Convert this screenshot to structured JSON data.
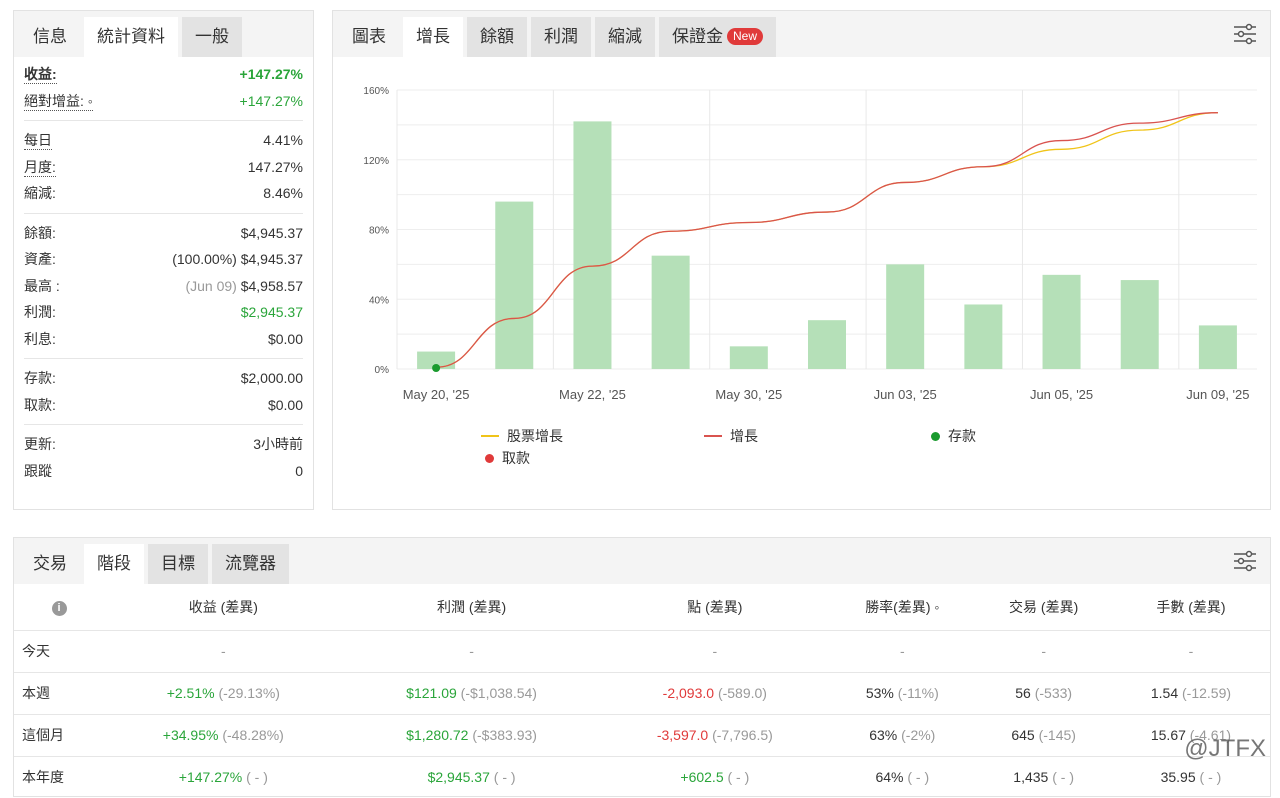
{
  "left": {
    "tabs": [
      "信息",
      "統計資料",
      "一般"
    ],
    "rows": [
      [
        {
          "k": "收益:",
          "v": "+147.27%",
          "c": "green",
          "b": true
        },
        {
          "k": "絕對增益: ◦",
          "v": "+147.27%",
          "c": "green"
        }
      ],
      [
        {
          "k": "每日",
          "v": "4.41%"
        },
        {
          "k": "月度:",
          "v": "147.27%"
        },
        {
          "k": "縮減:",
          "v": "8.46%",
          "nd": true
        }
      ],
      [
        {
          "k": "餘額:",
          "v": "$4,945.37",
          "nd": true
        },
        {
          "k": "資產:",
          "pre": "(100.00%)",
          "v": "$4,945.37",
          "nd": true
        },
        {
          "k": "最高 :",
          "pre": "(Jun 09)",
          "v": "$4,958.57",
          "nd": true
        },
        {
          "k": "利潤:",
          "v": "$2,945.37",
          "c": "green",
          "nd": true
        },
        {
          "k": "利息:",
          "v": "$0.00",
          "nd": true
        }
      ],
      [
        {
          "k": "存款:",
          "v": "$2,000.00",
          "nd": true
        },
        {
          "k": "取款:",
          "v": "$0.00",
          "nd": true
        }
      ],
      [
        {
          "k": "更新:",
          "v": "3小時前",
          "nd": true
        },
        {
          "k": "跟蹤",
          "v": "0",
          "nd": true
        }
      ]
    ]
  },
  "chart_tabs": [
    "圖表",
    "增長",
    "餘額",
    "利潤",
    "縮減",
    "保證金"
  ],
  "new_badge": "New",
  "chart_data": {
    "type": "bar+line",
    "yticks": [
      "0%",
      "40%",
      "80%",
      "120%",
      "160%"
    ],
    "ylim": [
      0,
      160
    ],
    "xlabels": [
      "May 20, '25",
      "May 22, '25",
      "May 30, '25",
      "Jun 03, '25",
      "Jun 05, '25",
      "Jun 09, '25"
    ],
    "bars": [
      10,
      96,
      142,
      65,
      13,
      28,
      60,
      37,
      54,
      51,
      25
    ],
    "growth": [
      1,
      29,
      59,
      79,
      84,
      90,
      107,
      116,
      131,
      141,
      147
    ],
    "equity_growth": [
      1,
      29,
      59,
      79,
      84,
      90,
      107,
      116,
      126,
      137,
      147
    ],
    "deposit_index": 0,
    "legend": [
      "股票增長",
      "增長",
      "存款",
      "取款"
    ],
    "colors": {
      "bar": "#b5e0b8",
      "growth": "#d9534f",
      "equity": "#f0c419",
      "deposit": "#1a9a2e",
      "withdraw": "#e03a3a"
    }
  },
  "bottom": {
    "tabs": [
      "交易",
      "階段",
      "目標",
      "流覽器"
    ],
    "headers": [
      "收益 (差異)",
      "利潤 (差異)",
      "點 (差異)",
      "勝率(差異) ◦",
      "交易 (差異)",
      "手數 (差異)"
    ],
    "rows": [
      {
        "label": "今天",
        "cells": [
          [
            "-",
            "",
            ""
          ],
          [
            "-",
            "",
            ""
          ],
          [
            "-",
            "",
            ""
          ],
          [
            "-",
            "",
            ""
          ],
          [
            "-",
            "",
            ""
          ],
          [
            "-",
            "",
            ""
          ]
        ]
      },
      {
        "label": "本週",
        "cells": [
          [
            "+2.51%",
            "(-29.13%)",
            "green"
          ],
          [
            "$121.09",
            "(-$1,038.54)",
            "green"
          ],
          [
            "-2,093.0",
            "(-589.0)",
            "red"
          ],
          [
            "53%",
            "(-11%)",
            ""
          ],
          [
            "56",
            "(-533)",
            ""
          ],
          [
            "1.54",
            "(-12.59)",
            ""
          ]
        ]
      },
      {
        "label": "這個月",
        "cells": [
          [
            "+34.95%",
            "(-48.28%)",
            "green"
          ],
          [
            "$1,280.72",
            "(-$383.93)",
            "green"
          ],
          [
            "-3,597.0",
            "(-7,796.5)",
            "red"
          ],
          [
            "63%",
            "(-2%)",
            ""
          ],
          [
            "645",
            "(-145)",
            ""
          ],
          [
            "15.67",
            "(-4.61)",
            ""
          ]
        ]
      },
      {
        "label": "本年度",
        "cells": [
          [
            "+147.27%",
            "( - )",
            "green"
          ],
          [
            "$2,945.37",
            "( - )",
            "green"
          ],
          [
            "+602.5",
            "( - )",
            "green"
          ],
          [
            "64%",
            "( - )",
            ""
          ],
          [
            "1,435",
            "( - )",
            ""
          ],
          [
            "35.95",
            "( - )",
            ""
          ]
        ]
      }
    ]
  },
  "watermark": "@JTFX"
}
